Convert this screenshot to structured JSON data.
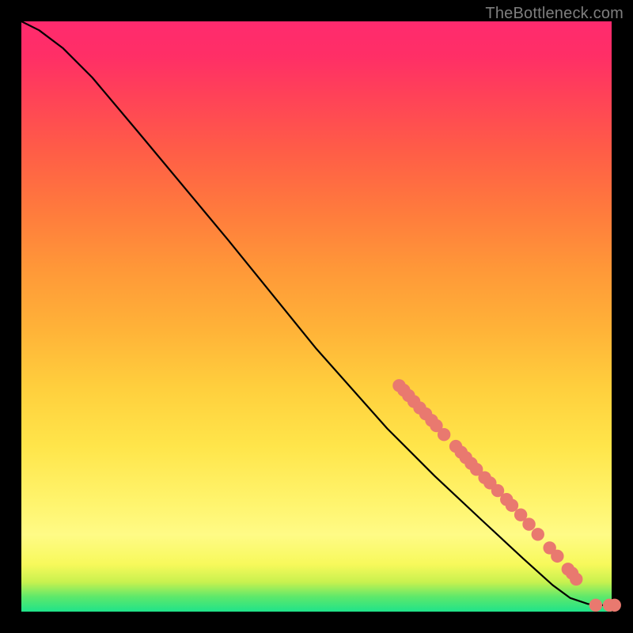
{
  "watermark": "TheBottleneck.com",
  "colors": {
    "curve": "#000000",
    "marker_fill": "#e9796f",
    "marker_stroke": "#ca5a52"
  },
  "chart_data": {
    "type": "line",
    "title": "",
    "xlabel": "",
    "ylabel": "",
    "xlim": [
      0,
      100
    ],
    "ylim": [
      0,
      100
    ],
    "curve": [
      {
        "x": 0,
        "y": 100
      },
      {
        "x": 3,
        "y": 98.5
      },
      {
        "x": 7,
        "y": 95.5
      },
      {
        "x": 12,
        "y": 90.5
      },
      {
        "x": 20,
        "y": 81
      },
      {
        "x": 35,
        "y": 63
      },
      {
        "x": 50,
        "y": 44.5
      },
      {
        "x": 62,
        "y": 31
      },
      {
        "x": 70,
        "y": 23
      },
      {
        "x": 78,
        "y": 15.5
      },
      {
        "x": 85,
        "y": 9
      },
      {
        "x": 90,
        "y": 4.5
      },
      {
        "x": 93,
        "y": 2.3
      },
      {
        "x": 96,
        "y": 1.3
      },
      {
        "x": 98,
        "y": 1.1
      },
      {
        "x": 100,
        "y": 1.1
      }
    ],
    "series": [
      {
        "name": "points",
        "points": [
          {
            "x": 64.0,
            "y": 38.3
          },
          {
            "x": 64.8,
            "y": 37.5
          },
          {
            "x": 65.6,
            "y": 36.6
          },
          {
            "x": 66.5,
            "y": 35.6
          },
          {
            "x": 67.5,
            "y": 34.5
          },
          {
            "x": 68.5,
            "y": 33.5
          },
          {
            "x": 69.5,
            "y": 32.4
          },
          {
            "x": 70.3,
            "y": 31.5
          },
          {
            "x": 71.6,
            "y": 30.0
          },
          {
            "x": 73.6,
            "y": 28.0
          },
          {
            "x": 74.5,
            "y": 27.0
          },
          {
            "x": 75.3,
            "y": 26.1
          },
          {
            "x": 76.2,
            "y": 25.1
          },
          {
            "x": 77.1,
            "y": 24.1
          },
          {
            "x": 78.5,
            "y": 22.7
          },
          {
            "x": 79.4,
            "y": 21.8
          },
          {
            "x": 80.7,
            "y": 20.5
          },
          {
            "x": 82.2,
            "y": 19.0
          },
          {
            "x": 83.1,
            "y": 18.0
          },
          {
            "x": 84.6,
            "y": 16.4
          },
          {
            "x": 86.0,
            "y": 14.8
          },
          {
            "x": 87.5,
            "y": 13.1
          },
          {
            "x": 89.5,
            "y": 10.8
          },
          {
            "x": 90.8,
            "y": 9.4
          },
          {
            "x": 92.6,
            "y": 7.2
          },
          {
            "x": 93.3,
            "y": 6.5
          },
          {
            "x": 94.0,
            "y": 5.5
          },
          {
            "x": 97.3,
            "y": 1.1
          },
          {
            "x": 99.6,
            "y": 1.1
          },
          {
            "x": 100.5,
            "y": 1.1
          }
        ]
      }
    ]
  }
}
